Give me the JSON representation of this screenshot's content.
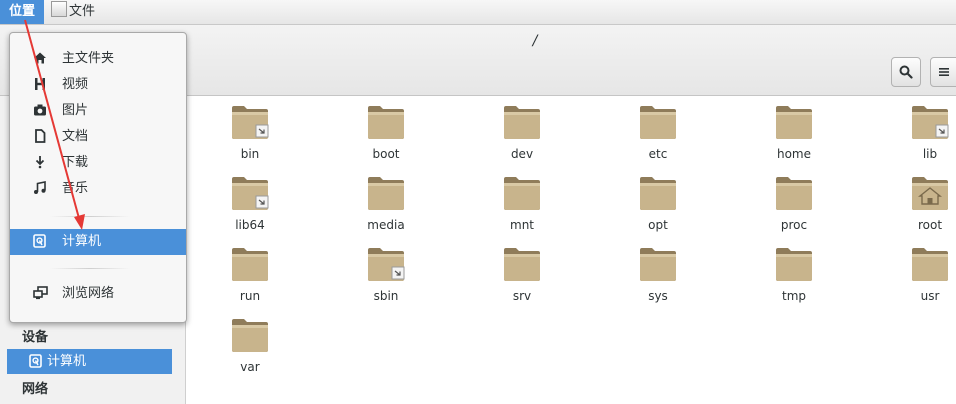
{
  "top_panel": {
    "places_label": "位置",
    "files_label": "文件"
  },
  "header": {
    "path": "/",
    "search_icon": "search-icon",
    "menu_icon": "hamburger-menu-icon"
  },
  "places_menu": {
    "items": [
      {
        "label": "主文件夹",
        "icon": "home-icon"
      },
      {
        "label": "视频",
        "icon": "film-icon"
      },
      {
        "label": "图片",
        "icon": "camera-icon"
      },
      {
        "label": "文档",
        "icon": "document-icon"
      },
      {
        "label": "下载",
        "icon": "download-icon"
      },
      {
        "label": "音乐",
        "icon": "music-icon"
      }
    ],
    "computer": {
      "label": "计算机",
      "icon": "computer-icon",
      "selected": true
    },
    "network": {
      "label": "浏览网络",
      "icon": "network-icon"
    }
  },
  "sidebar": {
    "devices_heading": "设备",
    "computer_label": "计算机",
    "network_heading": "网络"
  },
  "files": [
    {
      "name": "bin",
      "link": true
    },
    {
      "name": "boot",
      "link": false
    },
    {
      "name": "dev",
      "link": false
    },
    {
      "name": "etc",
      "link": false
    },
    {
      "name": "home",
      "link": false
    },
    {
      "name": "lib",
      "link": true
    },
    {
      "name": "lib64",
      "link": true
    },
    {
      "name": "media",
      "link": false
    },
    {
      "name": "mnt",
      "link": false
    },
    {
      "name": "opt",
      "link": false
    },
    {
      "name": "proc",
      "link": false
    },
    {
      "name": "root",
      "link": false,
      "home_emblem": true
    },
    {
      "name": "run",
      "link": false
    },
    {
      "name": "sbin",
      "link": true
    },
    {
      "name": "srv",
      "link": false
    },
    {
      "name": "sys",
      "link": false
    },
    {
      "name": "tmp",
      "link": false
    },
    {
      "name": "usr",
      "link": false
    },
    {
      "name": "var",
      "link": false
    }
  ],
  "colors": {
    "selection": "#4a90d9",
    "folder": "#c8b48c",
    "annotation_arrow": "#e53935"
  }
}
